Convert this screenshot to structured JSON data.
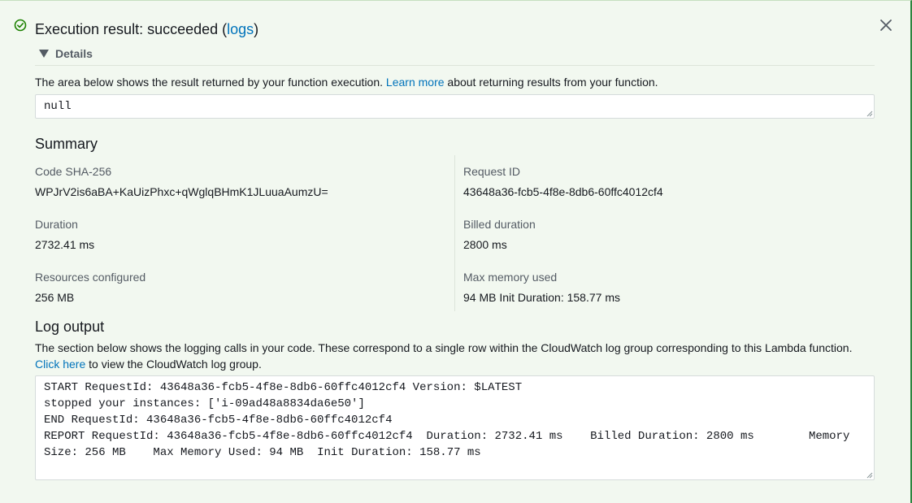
{
  "header": {
    "title_prefix": "Execution result: succeeded (",
    "logs_link": "logs",
    "title_suffix": ")",
    "details_label": "Details"
  },
  "result": {
    "description_pre": "The area below shows the result returned by your function execution.",
    "learn_more": "Learn more",
    "description_post": "about returning results from your function.",
    "value": "null"
  },
  "summary": {
    "heading": "Summary",
    "code_sha_label": "Code SHA-256",
    "code_sha_value": "WPJrV2is6aBA+KaUizPhxc+qWglqBHmK1JLuuaAumzU=",
    "request_id_label": "Request ID",
    "request_id_value": "43648a36-fcb5-4f8e-8db6-60ffc4012cf4",
    "duration_label": "Duration",
    "duration_value": "2732.41 ms",
    "billed_label": "Billed duration",
    "billed_value": "2800 ms",
    "resources_label": "Resources configured",
    "resources_value": "256 MB",
    "max_mem_label": "Max memory used",
    "max_mem_value": "94 MB Init Duration: 158.77 ms"
  },
  "log": {
    "heading": "Log output",
    "description": "The section below shows the logging calls in your code. These correspond to a single row within the CloudWatch log group corresponding to this Lambda function.",
    "click_here": "Click here",
    "description_post": "to view the CloudWatch log group.",
    "output": "START RequestId: 43648a36-fcb5-4f8e-8db6-60ffc4012cf4 Version: $LATEST\nstopped your instances: ['i-09ad48a8834da6e50']\nEND RequestId: 43648a36-fcb5-4f8e-8db6-60ffc4012cf4\nREPORT RequestId: 43648a36-fcb5-4f8e-8db6-60ffc4012cf4\tDuration: 2732.41 ms\tBilled Duration: 2800 ms\tMemory Size: 256 MB\tMax Memory Used: 94 MB\tInit Duration: 158.77 ms"
  },
  "colors": {
    "success": "#1d8102",
    "link": "#0073bb",
    "panel_bg": "#f2f8f0"
  },
  "icons": [
    "success-check-icon",
    "close-icon",
    "caret-down-icon"
  ]
}
